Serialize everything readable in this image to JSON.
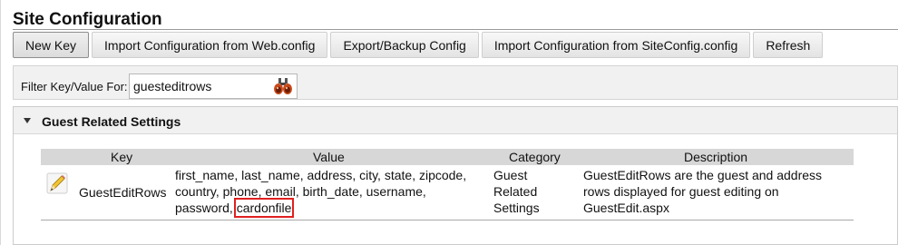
{
  "page": {
    "title": "Site Configuration"
  },
  "toolbar": {
    "buttons": [
      "New Key",
      "Import Configuration from Web.config",
      "Export/Backup Config",
      "Import Configuration from SiteConfig.config",
      "Refresh"
    ]
  },
  "filter": {
    "label": "Filter Key/Value For:",
    "value": "guesteditrows",
    "icon": "binoculars-icon"
  },
  "section": {
    "title": "Guest Related Settings",
    "columns": {
      "key": "Key",
      "value": "Value",
      "category": "Category",
      "description": "Description"
    },
    "rows": [
      {
        "key": "GuestEditRows",
        "value_lines": [
          "first_name, last_name, address, city, state, zipcode,",
          "country, phone, email, birth_date, username,",
          "password,"
        ],
        "value_highlight": "cardonfile",
        "category_lines": [
          "Guest",
          "Related",
          "Settings"
        ],
        "description_lines": [
          "GuestEditRows are the guest and address",
          "rows displayed for guest editing on",
          "GuestEdit.aspx"
        ]
      }
    ]
  },
  "colors": {
    "highlight_border": "#e02020",
    "header_bg": "#d7d7d7"
  }
}
